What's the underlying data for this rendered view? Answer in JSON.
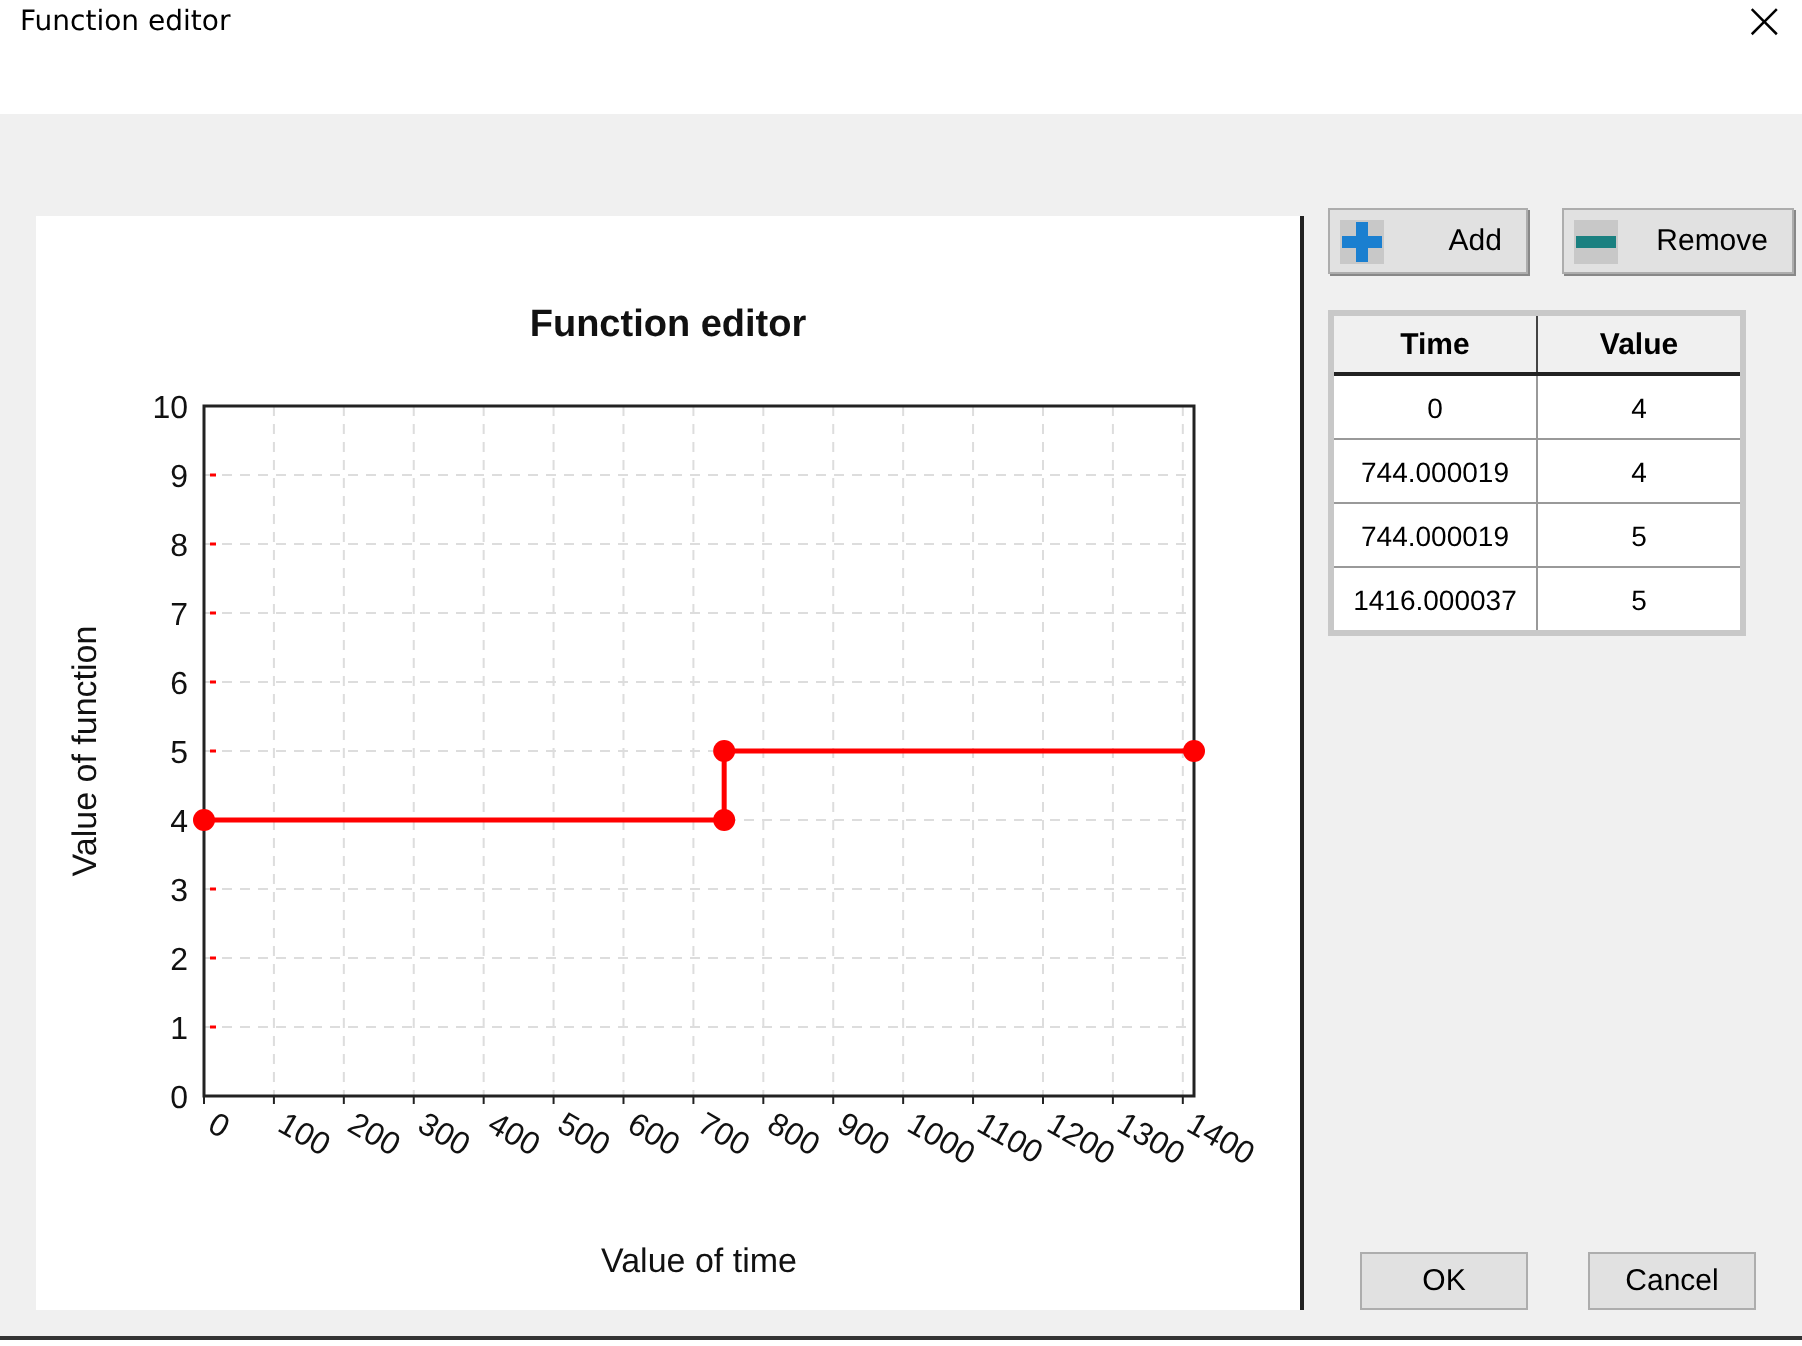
{
  "window": {
    "title": "Function editor",
    "close": "×"
  },
  "chart": {
    "chart_data": {
      "type": "line",
      "title": "Function editor",
      "xlabel": "Value of time",
      "ylabel": "Value of function",
      "x": [
        0,
        744.000019,
        744.000019,
        1416.000037
      ],
      "series": [
        {
          "color": "#ff0000",
          "marker": "circle",
          "values": [
            4,
            4,
            5,
            5
          ]
        }
      ],
      "grid": true,
      "xlim": [
        0,
        1416.000037
      ],
      "ylim": [
        0,
        10
      ],
      "xticks": [
        0,
        100,
        200,
        300,
        400,
        500,
        600,
        700,
        800,
        900,
        1000,
        1100,
        1200,
        1300,
        1400
      ],
      "yticks": [
        0,
        1,
        2,
        3,
        4,
        5,
        6,
        7,
        8,
        9,
        10
      ]
    }
  },
  "toolbar": [
    {
      "kind": "add",
      "label": "Add"
    },
    {
      "kind": "remove",
      "label": "Remove"
    }
  ],
  "table": {
    "columns": [
      "Time",
      "Value"
    ],
    "rows": [
      [
        "0",
        "4"
      ],
      [
        "744.000019",
        "4"
      ],
      [
        "744.000019",
        "5"
      ],
      [
        "1416.000037",
        "5"
      ]
    ]
  },
  "buttons": [
    "OK",
    "Cancel"
  ]
}
